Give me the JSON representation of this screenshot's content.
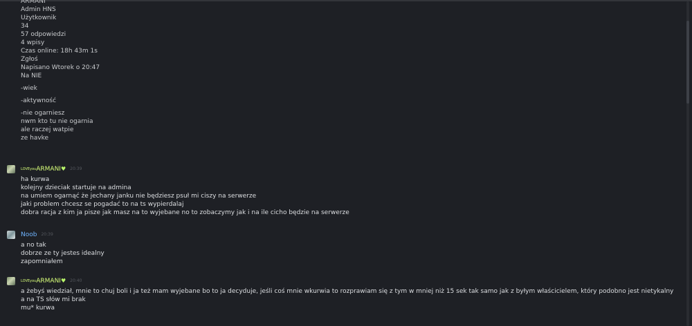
{
  "quote": {
    "author": "ARMANI",
    "role": "Admin HNS",
    "group": "Użytkownik",
    "count": "34",
    "replies": "57 odpowiedzi",
    "posts": "4 wpisy",
    "online": "Czas online: 18h 43m 1s",
    "report": "Zgłoś",
    "posted": "Napisano Wtorek o 20:47",
    "lines": [
      "Na NIE",
      "-wiek",
      "-aktywność",
      "-nie ogarniesz",
      "nwm kto tu nie ogarnia",
      "ale raczej watpie",
      "ze havke"
    ]
  },
  "messages": [
    {
      "author_small": "LOVEyou",
      "author": "ARMANI",
      "heart": "♥",
      "time": "20:39",
      "lines": [
        "ha kurwa",
        "kolejny dzieciak startuje na admina",
        "na umiem ogarnąć że jechany janku nie będziesz psuł mi ciszy na serwerze",
        "jaki problem chcesz se pogadać to na ts wypierdalaj",
        "dobra racja z kim ja pisze jak masz na to wyjebane no to zobaczymy jak i na ile cicho będzie na serwerze"
      ]
    },
    {
      "author": "Noob",
      "time": "20:39",
      "lines": [
        "a no tak",
        "dobrze ze ty jestes idealny",
        "zapomniałem"
      ]
    },
    {
      "author_small": "LOVEyou",
      "author": "ARMANI",
      "heart": "♥",
      "time": "20:40",
      "lines": [
        "a żebyś wiedział, mnie to chuj boli i ja też mam wyjebane bo to ja decyduje, jeśli coś mnie wkurwia to rozprawiam się z tym w mniej niż 15 sek tak samo jak z byłym właścicielem, który podobno jest nietykalny a na TS słów mi brak",
        "mu* kurwa"
      ]
    }
  ]
}
